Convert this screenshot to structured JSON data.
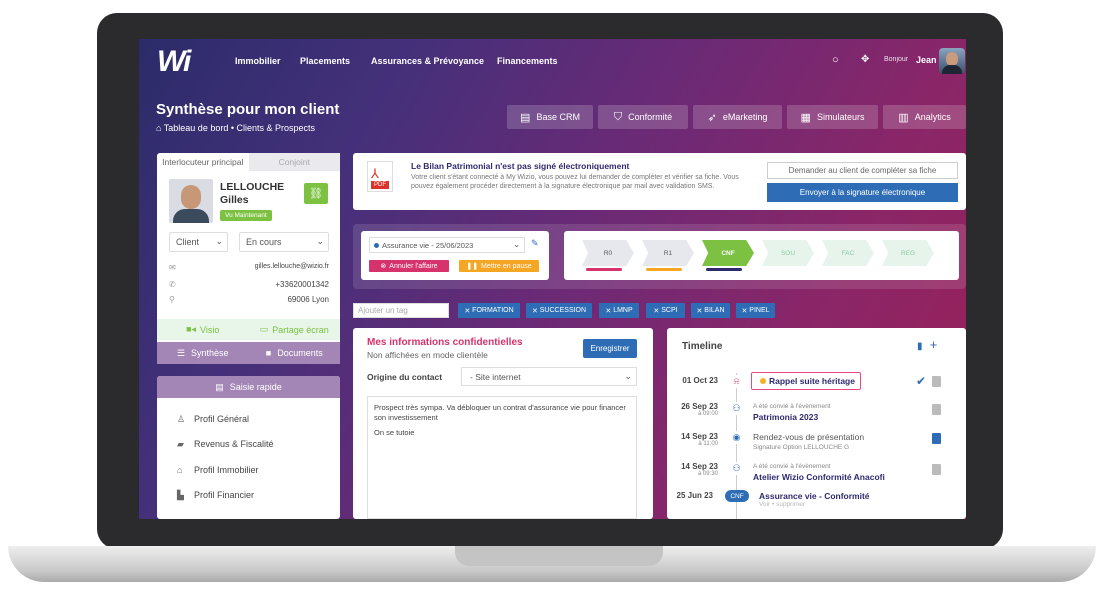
{
  "nav": {
    "logo": "Wi",
    "items": [
      "Immobilier",
      "Placements",
      "Assurances & Prévoyance",
      "Financements"
    ],
    "greeting": "Bonjour",
    "user": "Jean"
  },
  "page": {
    "title": "Synthèse pour mon client",
    "breadcrumb": "Tableau de bord • Clients & Prospects"
  },
  "toolbar": [
    "Base CRM",
    "Conformité",
    "eMarketing",
    "Simulateurs",
    "Analytics"
  ],
  "contact": {
    "tab_main": "Interlocuteur principal",
    "tab_other": "Conjoint",
    "last_name": "LELLOUCHE",
    "first_name": "Gilles",
    "badge": "Vu Maintenant",
    "type": "Client",
    "status": "En cours",
    "email": "gilles.lellouche@wizio.fr",
    "phone": "+33620001342",
    "location": "69006 Lyon",
    "video": "Visio",
    "share": "Partage écran",
    "synthese": "Synthèse",
    "documents": "Documents"
  },
  "saisie": {
    "title": "Saisie rapide",
    "items": [
      "Profil Général",
      "Revenus & Fiscalité",
      "Profil Immobilier",
      "Profil Financier"
    ]
  },
  "alert": {
    "pdf_label": "PDF",
    "title": "Le Bilan Patrimonial n'est pas signé électroniquement",
    "desc": "Votre client s'étant connecté à My Wizio, vous pouvez lui demander de compléter et vérifier sa fiche. Vous pouvez également procéder directement à la signature électronique par mail avec validation SMS.",
    "btn_ask": "Demander au client de compléter sa fiche",
    "btn_sign": "Envoyer à la signature électronique"
  },
  "deal": {
    "selected": "Assurance vie - 25/06/2023",
    "cancel": "Annuler l'affaire",
    "pause": "Mettre en pause",
    "steps": [
      "R0",
      "R1",
      "CNF",
      "SOU",
      "FAC",
      "REG"
    ]
  },
  "tags": {
    "placeholder": "Ajouter un tag",
    "items": [
      "FORMATION",
      "SUCCESSION",
      "LMNP",
      "SCPI",
      "BILAN",
      "PINEL"
    ]
  },
  "info": {
    "title": "Mes informations confidentielles",
    "subtitle": "Non affichées en mode clientèle",
    "save": "Enregistrer",
    "origin_label": "Origine du contact",
    "origin_value": "- Site internet",
    "note1": "Prospect très sympa.  Va débloquer un contrat d'assurance vie pour financer son investissement",
    "note2": "On se tutoie"
  },
  "timeline": {
    "title": "Timeline",
    "events": [
      {
        "date": "01 Oct 23",
        "time": "",
        "small": "",
        "text": "Rappel suite héritage"
      },
      {
        "date": "26 Sep 23",
        "time": "à 09:00",
        "small": "A été convié à l'évènement",
        "text": "Patrimonia 2023"
      },
      {
        "date": "14 Sep 23",
        "time": "à 11:00",
        "small": "Signature Option LELLOUCHE G",
        "text": "Rendez-vous de présentation"
      },
      {
        "date": "14 Sep 23",
        "time": "à 09:30",
        "small": "A été convié à l'évènement",
        "text": "Atelier Wizio Conformité Anacofi"
      },
      {
        "date": "25 Jun 23",
        "time": "",
        "small": "Voir • supprimer",
        "text": "Assurance vie - Conformité",
        "badge": "CNF"
      }
    ]
  }
}
